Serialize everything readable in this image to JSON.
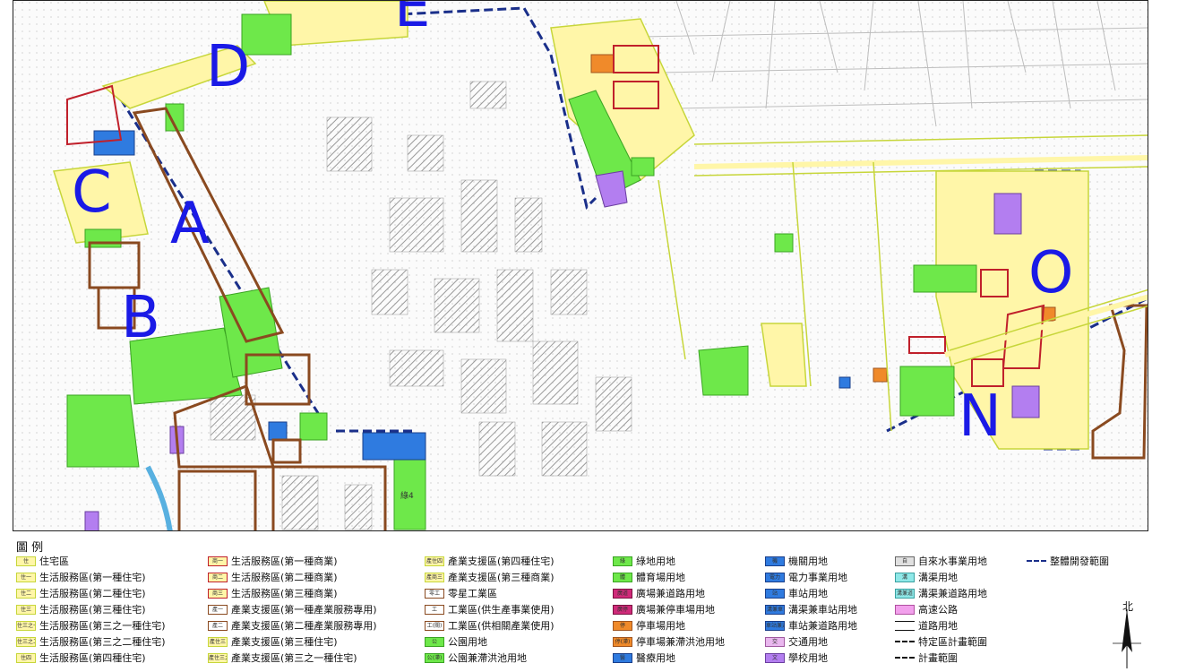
{
  "map": {
    "zone_labels": [
      "D",
      "E",
      "C",
      "A",
      "B",
      "O",
      "N"
    ],
    "small_labels": [
      "綠4"
    ],
    "colors": {
      "residential": "#fff6a8",
      "park": "#6ee84a",
      "school": "#b37ef0",
      "commercial_outline": "#c0202b",
      "industrial_outline": "#8a4a20",
      "plan_boundary": "#1a2f8a",
      "government": "#2f7be0",
      "parking": "#f08a2a",
      "road_outline": "#c7d63a",
      "building": "#bfbfbf"
    }
  },
  "legend": {
    "title": "圖  例",
    "col1": [
      {
        "code": "住",
        "label": "住宅區"
      },
      {
        "code": "住一",
        "label": "生活服務區(第一種住宅)"
      },
      {
        "code": "住二",
        "label": "生活服務區(第二種住宅)"
      },
      {
        "code": "住三",
        "label": "生活服務區(第三種住宅)"
      },
      {
        "code": "住三之一",
        "label": "生活服務區(第三之一種住宅)"
      },
      {
        "code": "住三之二",
        "label": "生活服務區(第三之二種住宅)"
      },
      {
        "code": "住四",
        "label": "生活服務區(第四種住宅)"
      }
    ],
    "col2": [
      {
        "code": "商一",
        "label": "生活服務區(第一種商業)"
      },
      {
        "code": "商二",
        "label": "生活服務區(第二種商業)"
      },
      {
        "code": "商三",
        "label": "生活服務區(第三種商業)"
      },
      {
        "code": "產一",
        "label": "產業支援區(第一種產業服務專用)"
      },
      {
        "code": "產二",
        "label": "產業支援區(第二種產業服務專用)"
      },
      {
        "code": "產住三",
        "label": "產業支援區(第三種住宅)"
      },
      {
        "code": "產住三之一",
        "label": "產業支援區(第三之一種住宅)"
      }
    ],
    "col3": [
      {
        "code": "產住四",
        "label": "產業支援區(第四種住宅)"
      },
      {
        "code": "產商三",
        "label": "產業支援區(第三種商業)"
      },
      {
        "code": "零工",
        "label": "零星工業區"
      },
      {
        "code": "工",
        "label": "工業區(供生產事業使用)"
      },
      {
        "code": "工(關)",
        "label": "工業區(供相關產業使用)"
      },
      {
        "code": "公",
        "label": "公園用地"
      },
      {
        "code": "公(滯)",
        "label": "公園兼滯洪池用地"
      }
    ],
    "col4": [
      {
        "code": "綠",
        "label": "綠地用地"
      },
      {
        "code": "體",
        "label": "體育場用地"
      },
      {
        "code": "廣道",
        "label": "廣場兼道路用地"
      },
      {
        "code": "廣停",
        "label": "廣場兼停車場用地"
      },
      {
        "code": "停",
        "label": "停車場用地"
      },
      {
        "code": "停(滯)",
        "label": "停車場兼滯洪池用地"
      },
      {
        "code": "醫",
        "label": "醫療用地"
      }
    ],
    "col5": [
      {
        "code": "機",
        "label": "機關用地"
      },
      {
        "code": "電力",
        "label": "電力事業用地"
      },
      {
        "code": "站",
        "label": "車站用地"
      },
      {
        "code": "溝兼車",
        "label": "溝渠兼車站用地"
      },
      {
        "code": "車站兼道",
        "label": "車站兼道路用地"
      },
      {
        "code": "交",
        "label": "交通用地"
      },
      {
        "code": "文",
        "label": "學校用地"
      }
    ],
    "col6": [
      {
        "code": "自",
        "label": "自來水事業用地"
      },
      {
        "code": "溝",
        "label": "溝渠用地"
      },
      {
        "code": "溝兼道",
        "label": "溝渠兼道路用地"
      },
      {
        "code": "",
        "label": "高速公路"
      },
      {
        "code": "",
        "label": "道路用地"
      },
      {
        "code": "",
        "label": "特定區計畫範圍"
      },
      {
        "code": "",
        "label": "計畫範圍"
      }
    ],
    "col7": [
      {
        "code": "",
        "label": "整體開發範圍"
      }
    ],
    "north": "北"
  }
}
